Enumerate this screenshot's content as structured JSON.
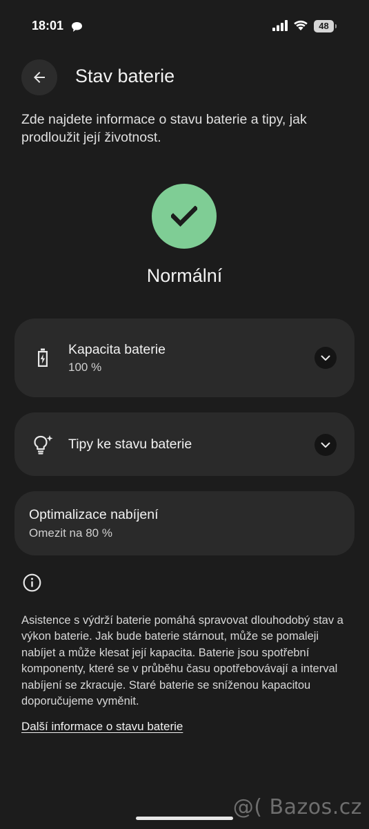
{
  "status_bar": {
    "time": "18:01",
    "battery_level": "48",
    "icons": [
      "chat-bubble-icon",
      "signal-icon",
      "wifi-icon",
      "battery-icon"
    ]
  },
  "header": {
    "title": "Stav baterie",
    "back_icon": "arrow-left-icon"
  },
  "intro": "Zde najdete informace o stavu baterie a tipy, jak prodloužit její životnost.",
  "status": {
    "label": "Normální",
    "icon": "check-icon",
    "color": "#7fcd95"
  },
  "cards": {
    "capacity": {
      "title": "Kapacita baterie",
      "value": "100 %",
      "icon": "battery-charging-icon"
    },
    "tips": {
      "title": "Tipy ke stavu baterie",
      "icon": "lightbulb-sparkle-icon"
    },
    "optimization": {
      "title": "Optimalizace nabíjení",
      "value": "Omezit na 80 %"
    }
  },
  "info": {
    "icon": "info-icon",
    "description": "Asistence s výdrží baterie pomáhá spravovat dlouhodobý stav a výkon baterie. Jak bude baterie stárnout, může se pomaleji nabíjet a může klesat její kapacita. Baterie jsou spotřební komponenty, které se v průběhu času opotřebovávají a interval nabíjení se zkracuje. Staré baterie se sníženou kapacitou doporučujeme vyměnit.",
    "link": "Další informace o stavu baterie"
  },
  "watermark": "@( Bazos.cz"
}
